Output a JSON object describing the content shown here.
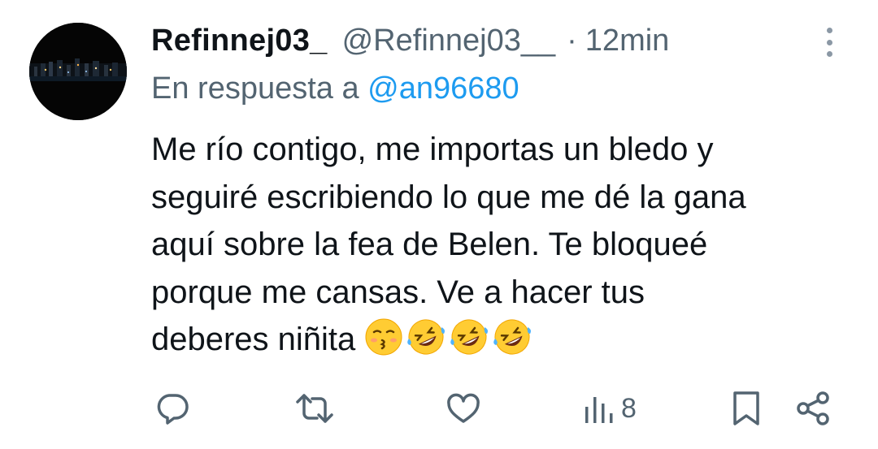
{
  "tweet": {
    "display_name": "Refinnej03_",
    "handle": "@Refinnej03__",
    "separator": "·",
    "time": "12min",
    "reply_prefix": "En respuesta a",
    "reply_mention": "@an96680",
    "text": "Me río contigo, me importas un bledo y\nseguiré escribiendo lo que me dé la gana\naquí sobre la fea de Belen. Te bloqueé\nporque me cansas. Ve a hacer tus\ndeberes niñita",
    "emojis": [
      "kissing-face-emoji",
      "rolling-on-floor-laughing-emoji",
      "rolling-on-floor-laughing-emoji",
      "rolling-on-floor-laughing-emoji"
    ]
  },
  "actions": {
    "reply_icon": "reply-icon",
    "retweet_icon": "retweet-icon",
    "like_icon": "like-icon",
    "views_icon": "views-icon",
    "views_count": "8",
    "bookmark_icon": "bookmark-icon",
    "share_icon": "share-icon"
  },
  "colors": {
    "text": "#0f1419",
    "secondary": "#536471",
    "link": "#1d9bf0",
    "icon": "#536471"
  }
}
